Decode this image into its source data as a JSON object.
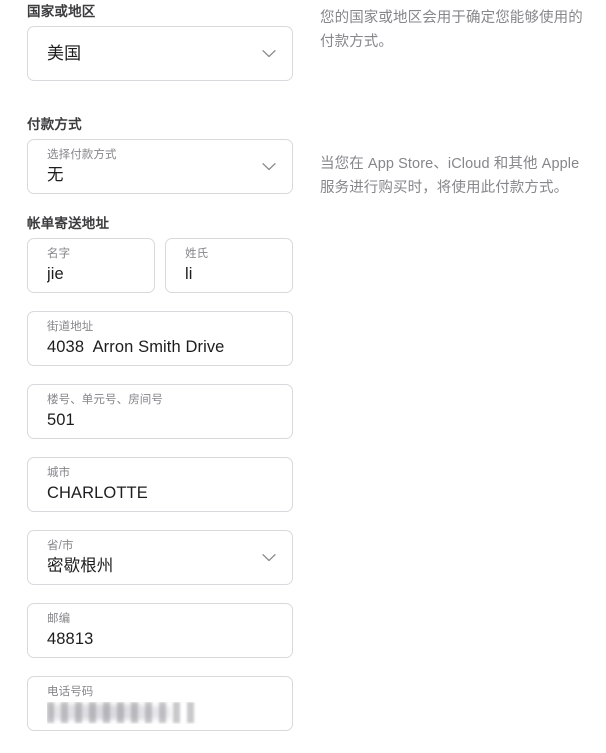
{
  "sections": {
    "country": {
      "label": "国家或地区",
      "field": {
        "value": "美国",
        "chevron_icon": "chevron-down-icon"
      },
      "helper": "您的国家或地区会用于确定您能够使用的付款方式。"
    },
    "payment": {
      "label": "付款方式",
      "field": {
        "label": "选择付款方式",
        "value": "无",
        "chevron_icon": "chevron-down-icon"
      },
      "helper": "当您在 App Store、iCloud 和其他 Apple 服务进行购买时，将使用此付款方式。"
    },
    "billing": {
      "label": "帐单寄送地址",
      "fields": {
        "first_name": {
          "label": "名字",
          "value": "jie"
        },
        "last_name": {
          "label": "姓氏",
          "value": "li"
        },
        "street": {
          "label": "街道地址",
          "value": "4038  Arron Smith Drive"
        },
        "apt": {
          "label": "楼号、单元号、房间号",
          "value": "501"
        },
        "city": {
          "label": "城市",
          "value": "CHARLOTTE"
        },
        "state": {
          "label": "省/市",
          "value": "密歇根州",
          "chevron_icon": "chevron-down-icon"
        },
        "zip": {
          "label": "邮编",
          "value": "48813"
        },
        "phone": {
          "label": "电话号码",
          "value": "3133355901",
          "redacted": true
        }
      }
    }
  },
  "colors": {
    "text": "#1d1d1f",
    "muted": "#86868b",
    "border": "#d9d9dd",
    "background": "#ffffff"
  }
}
